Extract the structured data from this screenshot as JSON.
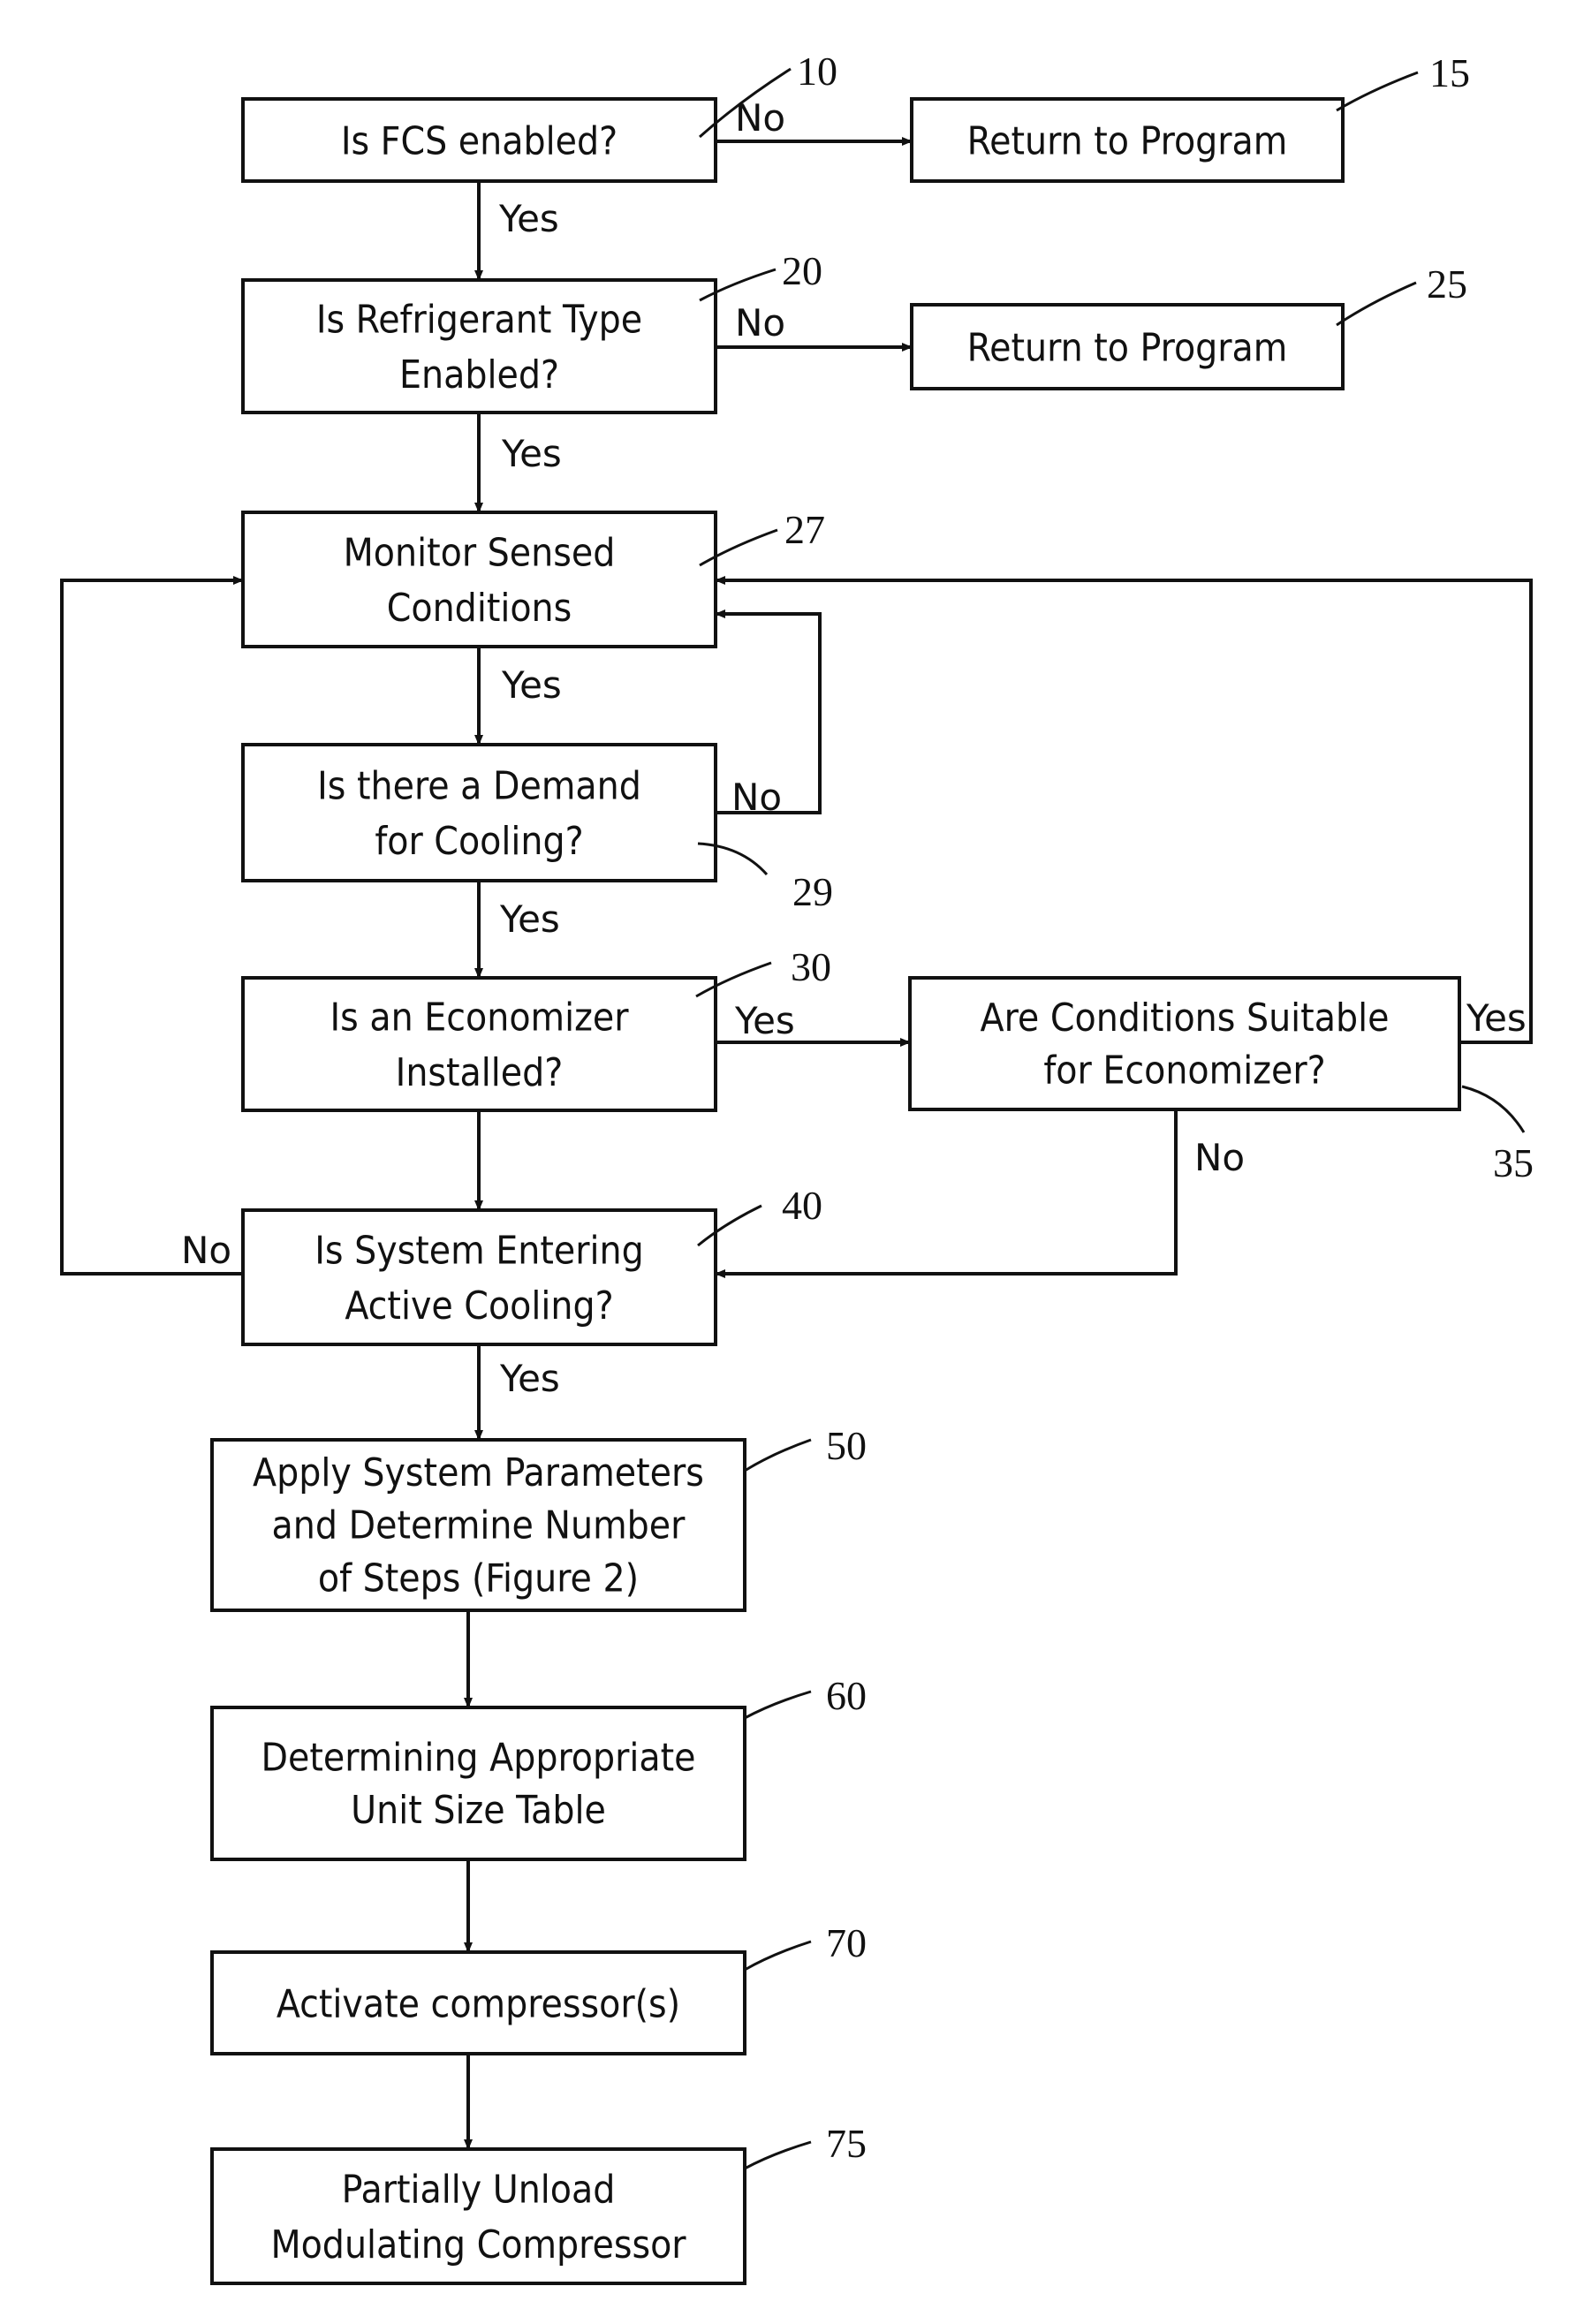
{
  "diagram": {
    "type": "flowchart",
    "colors": {
      "stroke": "#111111",
      "background": "#ffffff"
    },
    "nodes": [
      {
        "id": "n10",
        "ref": "10",
        "lines": [
          "Is FCS enabled?"
        ]
      },
      {
        "id": "n15",
        "ref": "15",
        "lines": [
          "Return to Program"
        ]
      },
      {
        "id": "n20",
        "ref": "20",
        "lines": [
          "Is Refrigerant Type",
          "Enabled?"
        ]
      },
      {
        "id": "n25",
        "ref": "25",
        "lines": [
          "Return to Program"
        ]
      },
      {
        "id": "n27",
        "ref": "27",
        "lines": [
          "Monitor Sensed",
          "Conditions"
        ]
      },
      {
        "id": "n29",
        "ref": "29",
        "lines": [
          "Is there a Demand",
          "for Cooling?"
        ]
      },
      {
        "id": "n30",
        "ref": "30",
        "lines": [
          "Is an Economizer",
          "Installed?"
        ]
      },
      {
        "id": "n35",
        "ref": "35",
        "lines": [
          "Are Conditions Suitable",
          "for Economizer?"
        ]
      },
      {
        "id": "n40",
        "ref": "40",
        "lines": [
          "Is System Entering",
          "Active Cooling?"
        ]
      },
      {
        "id": "n50",
        "ref": "50",
        "lines": [
          "Apply System Parameters",
          "and Determine Number",
          "of Steps (Figure 2)"
        ]
      },
      {
        "id": "n60",
        "ref": "60",
        "lines": [
          "Determining Appropriate",
          "Unit Size Table"
        ]
      },
      {
        "id": "n70",
        "ref": "70",
        "lines": [
          "Activate compressor(s)"
        ]
      },
      {
        "id": "n75",
        "ref": "75",
        "lines": [
          "Partially Unload",
          "Modulating Compressor"
        ]
      }
    ],
    "edges": [
      {
        "id": "e10-15",
        "from": "n10",
        "to": "n15",
        "label": "No"
      },
      {
        "id": "e10-20",
        "from": "n10",
        "to": "n20",
        "label": "Yes"
      },
      {
        "id": "e20-25",
        "from": "n20",
        "to": "n25",
        "label": "No"
      },
      {
        "id": "e20-27",
        "from": "n20",
        "to": "n27",
        "label": "Yes"
      },
      {
        "id": "e27-29",
        "from": "n27",
        "to": "n29",
        "label": "Yes"
      },
      {
        "id": "e29-27",
        "from": "n29",
        "to": "n27",
        "label": "No"
      },
      {
        "id": "e29-30",
        "from": "n29",
        "to": "n30",
        "label": "Yes"
      },
      {
        "id": "e30-35",
        "from": "n30",
        "to": "n35",
        "label": "Yes"
      },
      {
        "id": "e30-40",
        "from": "n30",
        "to": "n40",
        "label": ""
      },
      {
        "id": "e35-27",
        "from": "n35",
        "to": "n27",
        "label": "Yes"
      },
      {
        "id": "e35-40",
        "from": "n35",
        "to": "n40",
        "label": "No"
      },
      {
        "id": "e40-27",
        "from": "n40",
        "to": "n27",
        "label": "No"
      },
      {
        "id": "e40-50",
        "from": "n40",
        "to": "n50",
        "label": "Yes"
      },
      {
        "id": "e50-60",
        "from": "n50",
        "to": "n60",
        "label": ""
      },
      {
        "id": "e60-70",
        "from": "n60",
        "to": "n70",
        "label": ""
      },
      {
        "id": "e70-75",
        "from": "n70",
        "to": "n75",
        "label": ""
      }
    ]
  }
}
